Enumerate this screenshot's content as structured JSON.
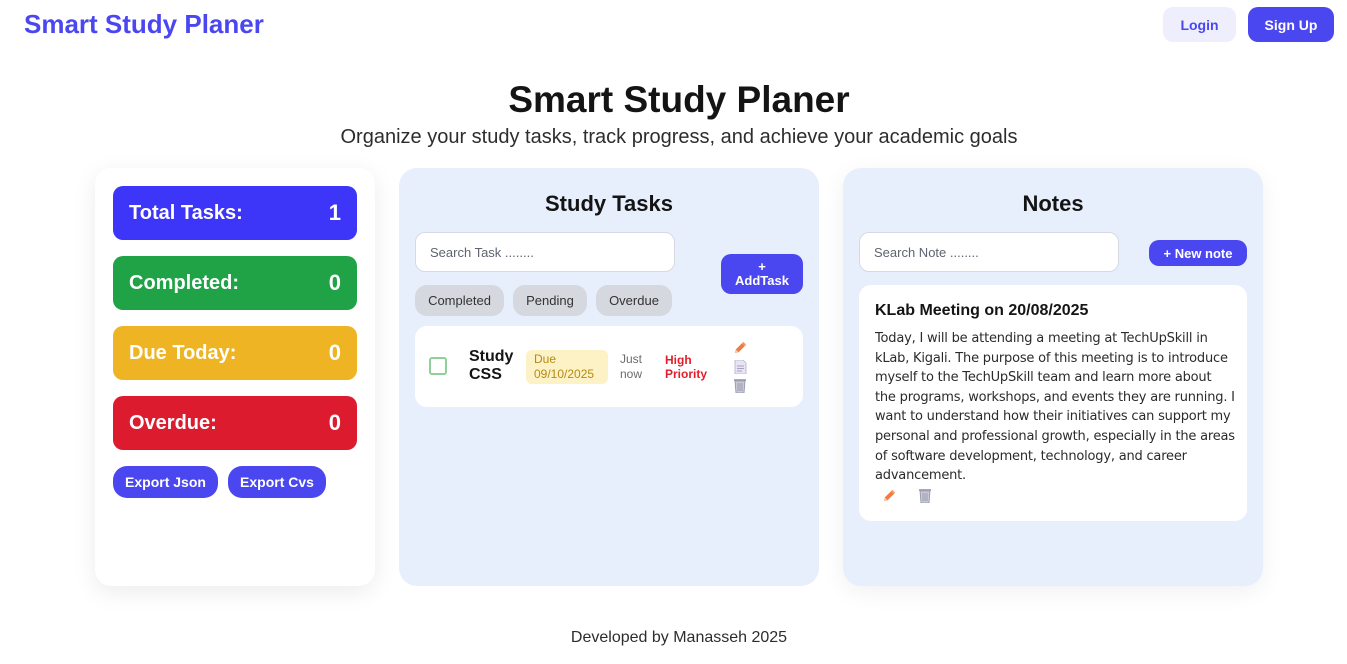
{
  "nav": {
    "brand": "Smart Study Planer",
    "login": "Login",
    "signup": "Sign Up"
  },
  "hero": {
    "title": "Smart Study Planer",
    "subtitle": "Organize your study tasks, track progress, and achieve your academic goals"
  },
  "stats": {
    "total_label": "Total Tasks:",
    "total_value": "1",
    "completed_label": "Completed:",
    "completed_value": "0",
    "due_label": "Due Today:",
    "due_value": "0",
    "overdue_label": "Overdue:",
    "overdue_value": "0",
    "export_json": "Export Json",
    "export_csv": "Export Cvs"
  },
  "tasks": {
    "title": "Study Tasks",
    "search_placeholder": "Search Task ........",
    "add_plus": "+",
    "add_label": "AddTask",
    "filters": [
      "Completed",
      "Pending",
      "Overdue"
    ],
    "items": [
      {
        "name": "Study CSS",
        "due_label": "Due",
        "due_date": "09/10/2025",
        "time": "Just now",
        "priority": "High Priority"
      }
    ]
  },
  "notes": {
    "title": "Notes",
    "search_placeholder": "Search Note ........",
    "new_note": "+ New note",
    "items": [
      {
        "title": "KLab Meeting on 20/08/2025",
        "body": "Today, I will be attending a meeting at TechUpSkill in kLab, Kigali. The purpose of this meeting is to introduce myself to the TechUpSkill team and learn more about the programs, workshops, and events they are running. I want to understand how their initiatives can support my personal and professional growth, especially in the areas of software development, technology, and career advancement."
      }
    ]
  },
  "footer": "Developed by Manasseh 2025",
  "colors": {
    "accent": "#4b47f0",
    "total": "#3d35f7",
    "completed": "#20a246",
    "due": "#efb423",
    "overdue": "#dc1c2e"
  },
  "icons": {
    "edit": "pencil-icon",
    "doc": "document-icon",
    "delete": "trash-icon"
  }
}
